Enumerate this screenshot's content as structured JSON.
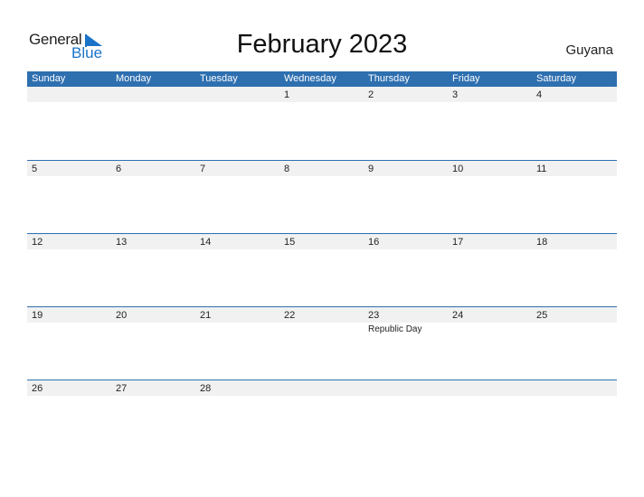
{
  "logo": {
    "general": "General",
    "blue": "Blue"
  },
  "title": "February 2023",
  "country": "Guyana",
  "colors": {
    "header": "#2e6fb0",
    "strip": "#f1f1f1",
    "brand_blue": "#1a73c8"
  },
  "weekdays": [
    "Sunday",
    "Monday",
    "Tuesday",
    "Wednesday",
    "Thursday",
    "Friday",
    "Saturday"
  ],
  "weeks": [
    [
      {
        "day": ""
      },
      {
        "day": ""
      },
      {
        "day": ""
      },
      {
        "day": "1"
      },
      {
        "day": "2"
      },
      {
        "day": "3"
      },
      {
        "day": "4"
      }
    ],
    [
      {
        "day": "5"
      },
      {
        "day": "6"
      },
      {
        "day": "7"
      },
      {
        "day": "8"
      },
      {
        "day": "9"
      },
      {
        "day": "10"
      },
      {
        "day": "11"
      }
    ],
    [
      {
        "day": "12"
      },
      {
        "day": "13"
      },
      {
        "day": "14"
      },
      {
        "day": "15"
      },
      {
        "day": "16"
      },
      {
        "day": "17"
      },
      {
        "day": "18"
      }
    ],
    [
      {
        "day": "19"
      },
      {
        "day": "20"
      },
      {
        "day": "21"
      },
      {
        "day": "22"
      },
      {
        "day": "23",
        "event": "Republic Day"
      },
      {
        "day": "24"
      },
      {
        "day": "25"
      }
    ],
    [
      {
        "day": "26"
      },
      {
        "day": "27"
      },
      {
        "day": "28"
      },
      {
        "day": ""
      },
      {
        "day": ""
      },
      {
        "day": ""
      },
      {
        "day": ""
      }
    ]
  ]
}
